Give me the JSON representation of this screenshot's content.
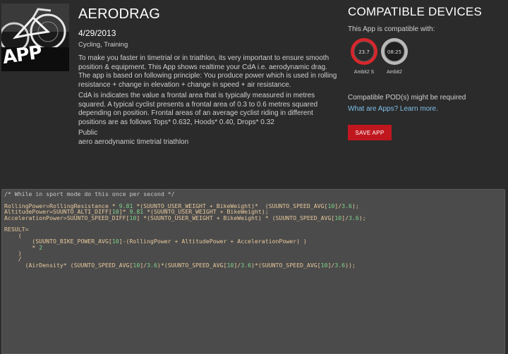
{
  "app": {
    "title": "AERODRAG",
    "date": "4/29/2013",
    "categories": "Cycling, Training",
    "thumbnail_label": "APP",
    "description": [
      "To make you faster in timetrial or in triathlon, its very important to ensure smooth position & equipment. This App shows realtime your CdA i.e. aerodynamic drag. The app is based on following principle: You produce power which is used in rolling resistance + change in elevation + change in speed + air resistance.",
      "CdA is indicates the value a frontal area that is typically measured in metres squared. A typical cyclist presents a frontal area of 0.3 to 0.6 metres squared depending on position. Frontal areas of an average cyclist riding in different positions are as follows Tops* 0.632, Hoods* 0.40, Drops* 0.32"
    ],
    "visibility": "Public",
    "tags": "aero aerodynamic timetrial triathlon"
  },
  "compatible": {
    "title": "COMPATIBLE DEVICES",
    "subtitle": "This App is compatible with:",
    "devices": [
      {
        "name": "Ambit2 S",
        "icon": "watch-red-icon",
        "color": "#d8262b"
      },
      {
        "name": "Ambit2",
        "icon": "watch-silver-icon",
        "color": "#b9b9b9"
      }
    ],
    "pod_text": "Compatible POD(s) might be required",
    "link_text": "What are Apps? Learn more.",
    "save_label": "SAVE APP"
  },
  "code": {
    "lines": [
      "/* While in sport mode do this once per second */",
      "",
      "RollingPower=RollingResistance * 9.81 *(SUUNTO_USER_WEIGHT + BikeWeight)*  (SUUNTO_SPEED_AVG[10]/3.6);",
      "AltitudePower=SUUNTO_ALTI_DIFF[10]* 9.81 *(SUUNTO_USER_WEIGHT + BikeWeight);",
      "AccelerationPower=SUUNTO_SPEED_DIFF[10] *(SUUNTO_USER_WEIGHT + BikeWeight) * (SUUNTO_SPEED_AVG[10]/3.6);",
      "",
      "RESULT=",
      "    (",
      "        (SUUNTO_BIKE_POWER_AVG[10]-(RollingPower + AltitudePower + AccelerationPower) )",
      "        * 2",
      "    )",
      "    /",
      "      (AirDensity* (SUUNTO_SPEED_AVG[10]/3.6)*(SUUNTO_SPEED_AVG[10]/3.6)*(SUUNTO_SPEED_AVG[10]/3.6));"
    ]
  }
}
